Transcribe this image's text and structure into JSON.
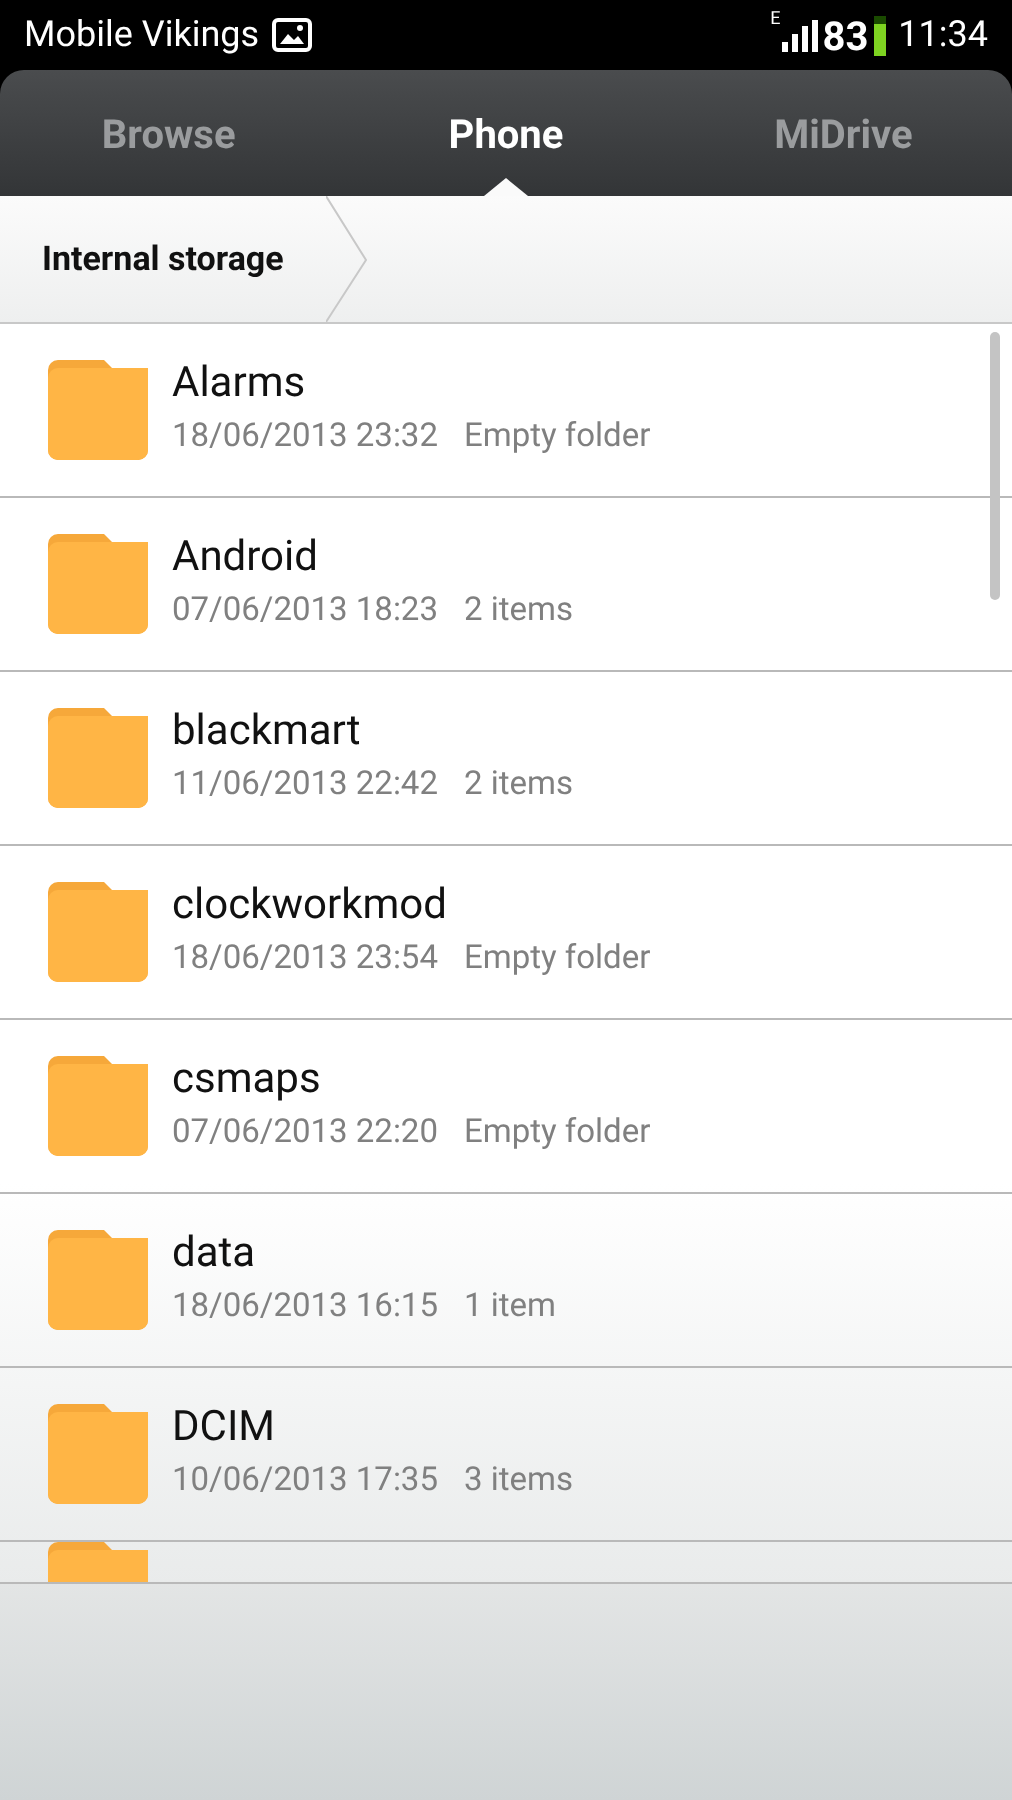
{
  "status_bar": {
    "carrier": "Mobile Vikings",
    "network_type": "E",
    "battery": "83",
    "time": "11:34"
  },
  "tabs": [
    {
      "label": "Browse",
      "selected": false
    },
    {
      "label": "Phone",
      "selected": true
    },
    {
      "label": "MiDrive",
      "selected": false
    }
  ],
  "breadcrumb": [
    {
      "label": "Internal storage"
    }
  ],
  "folders": [
    {
      "name": "Alarms",
      "date": "18/06/2013 23:32",
      "info": "Empty folder"
    },
    {
      "name": "Android",
      "date": "07/06/2013 18:23",
      "info": "2 items"
    },
    {
      "name": "blackmart",
      "date": "11/06/2013 22:42",
      "info": "2 items"
    },
    {
      "name": "clockworkmod",
      "date": "18/06/2013 23:54",
      "info": "Empty folder"
    },
    {
      "name": "csmaps",
      "date": "07/06/2013 22:20",
      "info": "Empty folder"
    },
    {
      "name": "data",
      "date": "18/06/2013 16:15",
      "info": "1 item"
    },
    {
      "name": "DCIM",
      "date": "10/06/2013 17:35",
      "info": "3 items"
    }
  ]
}
